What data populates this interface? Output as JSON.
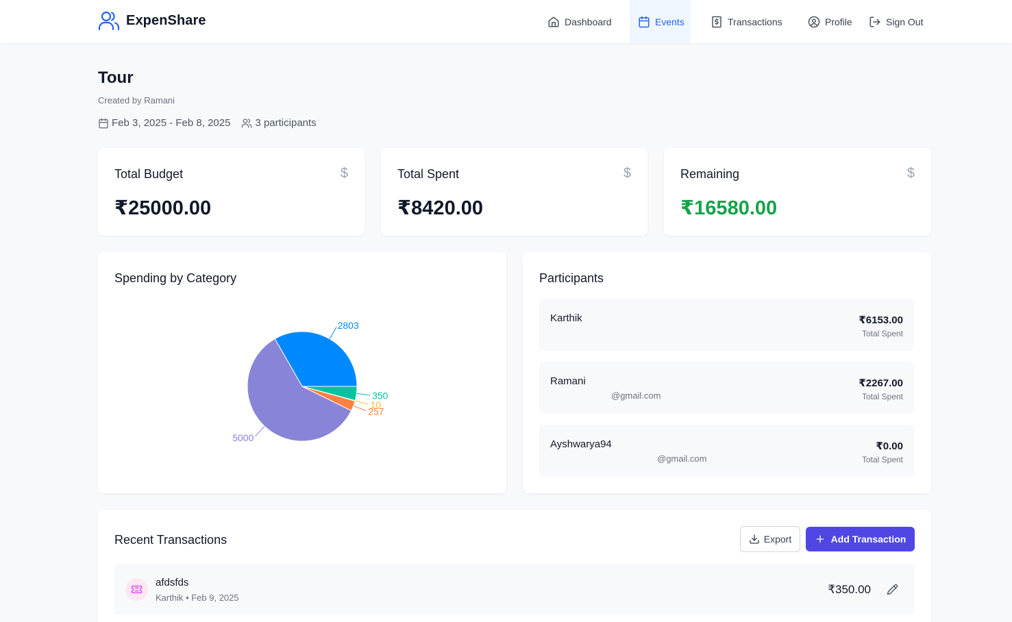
{
  "app": {
    "name": "ExpenShare"
  },
  "nav": {
    "dashboard": "Dashboard",
    "events": "Events",
    "transactions": "Transactions",
    "profile": "Profile",
    "sign_out": "Sign Out"
  },
  "event": {
    "title": "Tour",
    "created_by": "Created by Ramani",
    "dates": "Feb 3, 2025 - Feb 8, 2025",
    "participants_count": "3 participants"
  },
  "stats": {
    "budget": {
      "label": "Total Budget",
      "value": "₹25000.00",
      "icon": "dollar-icon"
    },
    "spent": {
      "label": "Total Spent",
      "value": "₹8420.00",
      "icon": "dollar-icon"
    },
    "remaining": {
      "label": "Remaining",
      "value": "₹16580.00",
      "icon": "dollar-icon",
      "color": "#16a34a"
    }
  },
  "spending": {
    "title": "Spending by Category"
  },
  "chart_data": {
    "type": "pie",
    "values": [
      2803,
      5000,
      257,
      10,
      350
    ],
    "labels": [
      "2803",
      "5000",
      "257",
      "10",
      "350"
    ],
    "colors": [
      "#0088fe",
      "#8884d8",
      "#ff8042",
      "#ffbb28",
      "#00c49f"
    ]
  },
  "participants": {
    "title": "Participants",
    "items": [
      {
        "name": "Karthik",
        "email": "",
        "amount": "₹6153.00",
        "sub": "Total Spent"
      },
      {
        "name": "Ramani",
        "email": "@gmail.com",
        "amount": "₹2267.00",
        "sub": "Total Spent"
      },
      {
        "name": "Ayshwarya94",
        "email": "@gmail.com",
        "amount": "₹0.00",
        "sub": "Total Spent"
      }
    ]
  },
  "transactions": {
    "title": "Recent Transactions",
    "export_label": "Export",
    "add_label": "Add Transaction",
    "items": [
      {
        "title": "afdsfds",
        "meta": "Karthik • Feb 9, 2025",
        "amount": "₹350.00"
      }
    ]
  },
  "colors": {
    "accent": "#4f46e5",
    "nav_active": "#2563eb",
    "positive": "#16a34a"
  }
}
